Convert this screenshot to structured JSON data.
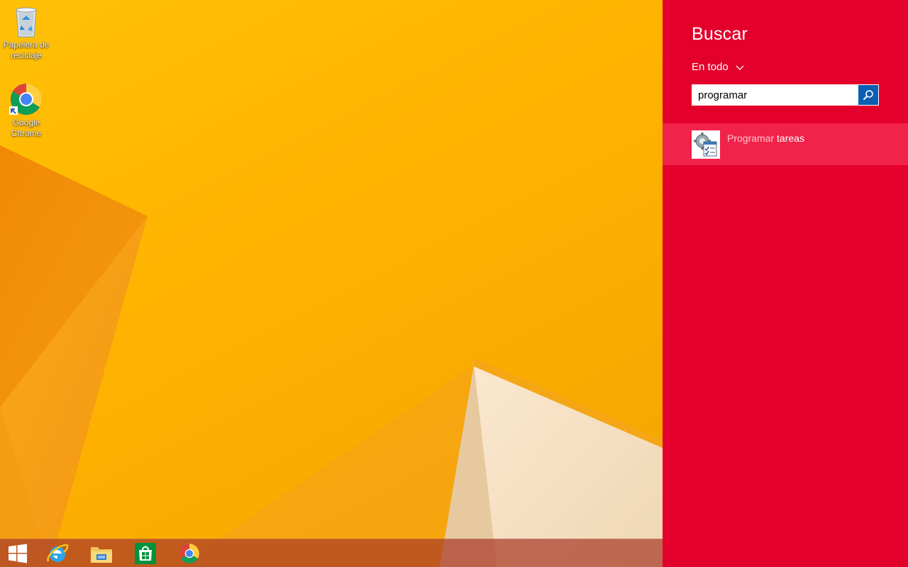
{
  "desktop": {
    "icons": [
      {
        "label": "Papelera de reciclaje"
      },
      {
        "label": "Google Chrome"
      }
    ]
  },
  "taskbar": {
    "items": [
      "start-icon",
      "internet-explorer-icon",
      "file-explorer-icon",
      "store-icon",
      "chrome-icon"
    ]
  },
  "search": {
    "title": "Buscar",
    "scope": "En todo",
    "query": "programar",
    "results": [
      {
        "match": "Programar",
        "rest": " tareas",
        "icon": "task-scheduler-icon"
      }
    ]
  },
  "colors": {
    "pane": "#e3002b",
    "result_highlight": "#f2234a",
    "search_button": "#0a5fb4",
    "wallpaper": "#ffbb00"
  }
}
